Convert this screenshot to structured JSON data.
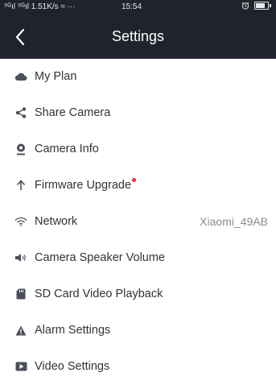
{
  "status_bar": {
    "left": "⁵ᴳıl ⁵ᴳıl 1.51K/s ≈ ···",
    "time": "15:54"
  },
  "header": {
    "title": "Settings",
    "back_icon": "chevron-left-icon"
  },
  "menu": [
    {
      "id": "my-plan",
      "label": "My Plan",
      "icon": "cloud-icon"
    },
    {
      "id": "share-camera",
      "label": "Share Camera",
      "icon": "share-icon"
    },
    {
      "id": "camera-info",
      "label": "Camera Info",
      "icon": "camera-info-icon"
    },
    {
      "id": "firmware-upgrade",
      "label": "Firmware Upgrade",
      "icon": "arrow-up-icon",
      "badge": true
    },
    {
      "id": "network",
      "label": "Network",
      "icon": "wifi-icon",
      "value": "Xiaomi_49AB"
    },
    {
      "id": "camera-speaker-volume",
      "label": "Camera Speaker Volume",
      "icon": "speaker-icon"
    },
    {
      "id": "sd-card-video-playback",
      "label": "SD Card Video Playback",
      "icon": "sd-card-icon"
    },
    {
      "id": "alarm-settings",
      "label": "Alarm Settings",
      "icon": "warning-icon"
    },
    {
      "id": "video-settings",
      "label": "Video Settings",
      "icon": "video-icon"
    }
  ],
  "colors": {
    "header_bg": "#1f232b",
    "icon": "#4a4f59",
    "text": "#333333",
    "value_text": "#8a8a8a",
    "badge": "#ff2d2d"
  }
}
